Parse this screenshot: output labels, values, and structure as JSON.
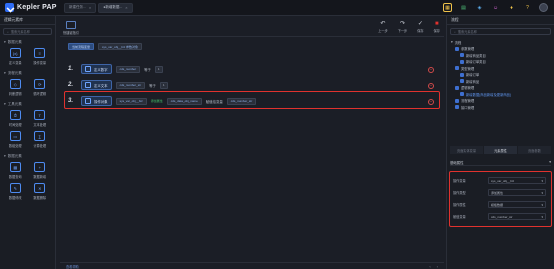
{
  "app": {
    "name": "Kepler PAP"
  },
  "tabs": [
    {
      "label": "新建任务...",
      "close": "×"
    },
    {
      "label": "●新增数据...",
      "close": "×"
    }
  ],
  "top_icons": [
    {
      "name": "grid-icon",
      "glyph": "▦",
      "color": "#f0c34a"
    },
    {
      "name": "document-icon",
      "glyph": "▤",
      "color": "#4fc37a"
    },
    {
      "name": "shirt-icon",
      "glyph": "◈",
      "color": "#5db0f0"
    },
    {
      "name": "person-icon",
      "glyph": "☺",
      "color": "#e06adf"
    },
    {
      "name": "bell-icon",
      "glyph": "♦",
      "color": "#f0c34a"
    },
    {
      "name": "help-icon",
      "glyph": "?",
      "color": "#f0c34a"
    }
  ],
  "left": {
    "title": "逻辑元素库",
    "search_placeholder": "搜索元素名称",
    "sections": [
      {
        "title": "数据元素",
        "items": [
          {
            "icon": "{x}",
            "label": "定义变量"
          },
          {
            "icon": "≡",
            "label": "操作变量"
          }
        ]
      },
      {
        "title": "流程元素",
        "items": [
          {
            "icon": "◇",
            "label": "判断逻辑"
          },
          {
            "icon": "⟳",
            "label": "循环逻辑"
          }
        ]
      },
      {
        "title": "工具元素",
        "items": [
          {
            "icon": "⏱",
            "label": "时间处理"
          },
          {
            "icon": "T",
            "label": "文本处理"
          },
          {
            "icon": "▭",
            "label": "数组处理"
          },
          {
            "icon": "∑",
            "label": "计算处理"
          }
        ]
      },
      {
        "title": "数据元素",
        "items": [
          {
            "icon": "▦",
            "label": "数据查询"
          },
          {
            "icon": "+",
            "label": "数据新增"
          },
          {
            "icon": "✎",
            "label": "数据修改"
          },
          {
            "icon": "✕",
            "label": "数据删除"
          }
        ]
      }
    ]
  },
  "toolbar": {
    "quick_label": "快捷键指引",
    "actions": [
      {
        "icon": "↶",
        "label": "上一步",
        "color": "#c9cdd6"
      },
      {
        "icon": "↷",
        "label": "下一步",
        "color": "#c9cdd6"
      },
      {
        "icon": "✓",
        "label": "保存",
        "color": "#c9cdd6"
      },
      {
        "icon": "■",
        "label": "保存",
        "color": "#e0322e"
      }
    ]
  },
  "canvas": {
    "header_chips": [
      "当前流程变量",
      "sys_var_obj__biz 参数对象"
    ],
    "rows": [
      {
        "num": "1.",
        "name": "定义数字",
        "var": "cds_number",
        "op": "等于",
        "val": "1"
      },
      {
        "num": "2.",
        "name": "定义文本",
        "var": "cds_number_str",
        "op": "等于",
        "val": "1"
      },
      {
        "num": "3.",
        "name": "操作对象",
        "var": "sys_var_obj__biz",
        "tag": "添加属性",
        "attr": "cds_data_obj_name",
        "op": "赋值给变量",
        "val": "cds_number_str"
      }
    ]
  },
  "right": {
    "title": "流程",
    "search_placeholder": "搜索元素名称",
    "tree": [
      {
        "label": "流程",
        "level": 0,
        "checked": false,
        "selected": false
      },
      {
        "label": "参数管理",
        "level": 1,
        "checked": true,
        "selected": false
      },
      {
        "label": "新增商品类目",
        "level": 2,
        "checked": true,
        "selected": false
      },
      {
        "label": "新增订单类目",
        "level": 2,
        "checked": true,
        "selected": false
      },
      {
        "label": "类型管理",
        "level": 1,
        "checked": true,
        "selected": false
      },
      {
        "label": "新增订单",
        "level": 2,
        "checked": true,
        "selected": false
      },
      {
        "label": "新增商品",
        "level": 2,
        "checked": true,
        "selected": false
      },
      {
        "label": "逻辑管理",
        "level": 1,
        "checked": true,
        "selected": false
      },
      {
        "label": "新增数据(商品新增及更新商品)",
        "level": 2,
        "checked": true,
        "selected": true
      },
      {
        "label": "流程管理",
        "level": 1,
        "checked": true,
        "selected": false
      },
      {
        "label": "接口管理",
        "level": 1,
        "checked": true,
        "selected": false
      }
    ],
    "tabs": [
      "页面实体变量",
      "元素属性",
      "页面参数"
    ],
    "props_title": "基础属性",
    "props_collapse": "▾",
    "props": [
      {
        "label": "操作变量",
        "value": "sys_var_obj__biz"
      },
      {
        "label": "操作类型",
        "value": "添加属性"
      },
      {
        "label": "操作属性",
        "value": "模板数据"
      },
      {
        "label": "赋值变量",
        "value": "cds_number_str"
      }
    ]
  },
  "bottom": {
    "link": "查看帮助",
    "prev": "‹",
    "next": "›"
  },
  "colors": {
    "accent": "#2f6df6",
    "highlight": "#e0322e",
    "panel": "#1a1d24"
  }
}
